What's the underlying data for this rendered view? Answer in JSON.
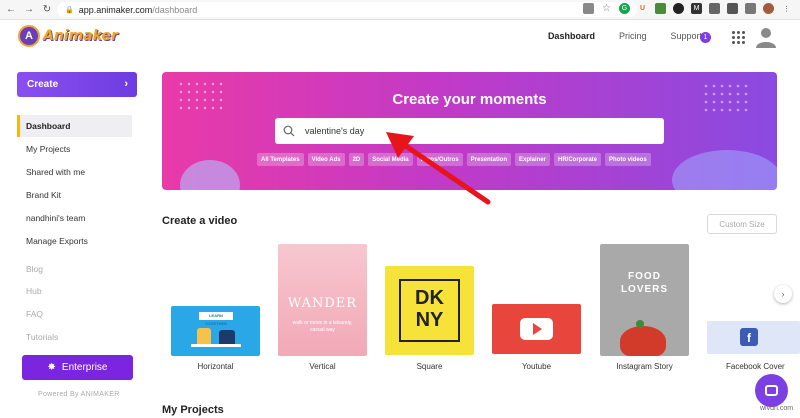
{
  "browser": {
    "url_host": "app.animaker.com",
    "url_path": "/dashboard",
    "back_glyph": "←",
    "forward_glyph": "→",
    "reload_glyph": "↻",
    "lock_glyph": "🔒"
  },
  "header": {
    "logo_text": "Animaker",
    "logo_letter": "A",
    "nav": [
      "Dashboard",
      "Pricing",
      "Support"
    ],
    "notification_count": "1"
  },
  "sidebar": {
    "create_label": "Create",
    "create_chevron": "›",
    "items": [
      {
        "label": "Dashboard"
      },
      {
        "label": "My Projects"
      },
      {
        "label": "Shared with me"
      },
      {
        "label": "Brand Kit"
      },
      {
        "label": "nandhini's team"
      },
      {
        "label": "Manage Exports"
      },
      {
        "label": "Blog"
      },
      {
        "label": "Hub"
      },
      {
        "label": "FAQ"
      },
      {
        "label": "Tutorials"
      }
    ],
    "enterprise_label": "Enterprise",
    "enterprise_icon": "✸",
    "powered_by": "Powered By ANIMAKER"
  },
  "banner": {
    "title": "Create your moments",
    "search_value": "valentine's day",
    "chips": [
      "All Templates",
      "Video Ads",
      "2D",
      "Social Media",
      "Intros/Outros",
      "Presentation",
      "Explainer",
      "HR/Corporate",
      "Photo videos"
    ]
  },
  "create_video": {
    "title": "Create a video",
    "custom_size": "Custom Size",
    "cards": [
      {
        "label": "Horizontal",
        "thumb_text": "LEARN TOGETHER"
      },
      {
        "label": "Vertical",
        "thumb_text": "WANDER",
        "thumb_sub": "walk or move in a leisurely, casual way"
      },
      {
        "label": "Square",
        "thumb_text": "DK NY"
      },
      {
        "label": "Youtube"
      },
      {
        "label": "Instagram Story",
        "thumb_text": "FOOD LOVERS"
      },
      {
        "label": "Facebook Cover",
        "thumb_text": "f"
      }
    ],
    "next_glyph": "›"
  },
  "my_projects": {
    "title": "My Projects"
  },
  "watermark": "wivdn.com",
  "colors": {
    "brand_purple": "#7c25e0",
    "accent_yellow": "#f5b80f",
    "arrow_red": "#e8141c"
  }
}
